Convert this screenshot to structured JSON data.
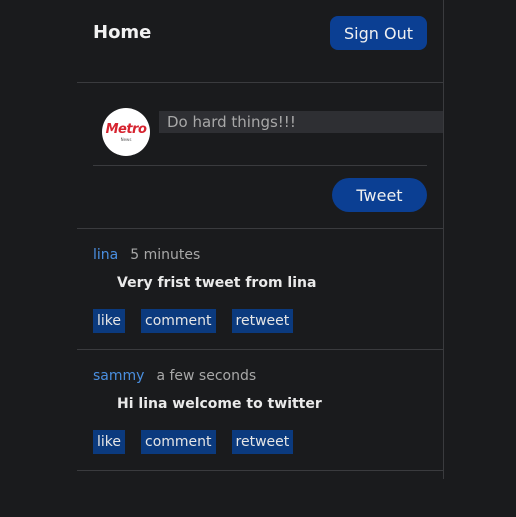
{
  "header": {
    "title": "Home",
    "signout_label": "Sign Out"
  },
  "composer": {
    "avatar_logo": "Metro",
    "avatar_sub": "News",
    "input_placeholder": "Do hard things!!!",
    "tweet_label": "Tweet"
  },
  "tweets": [
    {
      "author": "lina",
      "time": "5 minutes",
      "body": "Very frist tweet from lina",
      "actions": {
        "like": "like",
        "comment": "comment",
        "retweet": "retweet"
      }
    },
    {
      "author": "sammy",
      "time": "a few seconds",
      "body": "Hi lina welcome to twitter",
      "actions": {
        "like": "like",
        "comment": "comment",
        "retweet": "retweet"
      }
    }
  ],
  "colors": {
    "background": "#1a1b1d",
    "accent": "#0b3f93",
    "author_link": "#4a8fe0"
  }
}
